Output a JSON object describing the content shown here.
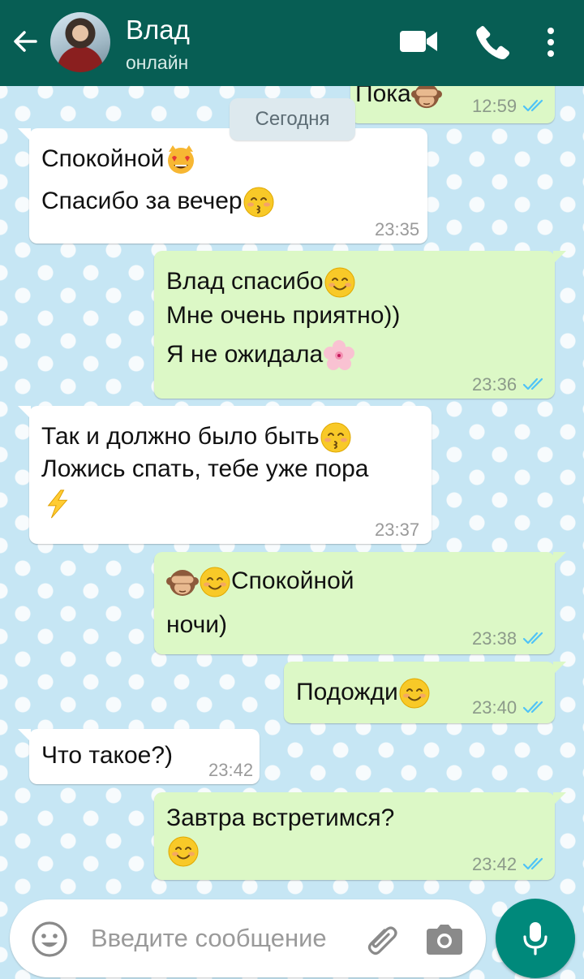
{
  "header": {
    "contact_name": "Влад",
    "status": "онлайн"
  },
  "date_divider": "Сегодня",
  "messages": [
    {
      "lines": [
        "Пока"
      ],
      "time": "12:59",
      "direction": "outgoing",
      "read": true,
      "emoji": [
        "see-no-evil-monkey"
      ]
    },
    {
      "lines": [
        "Спокойной",
        "Спасибо за вечер"
      ],
      "time": "23:35",
      "direction": "incoming",
      "emoji": [
        "heart-eyes-cat",
        "kissing-face"
      ]
    },
    {
      "lines": [
        "Влад спасибо",
        "Мне очень приятно))",
        "Я не ожидала"
      ],
      "time": "23:36",
      "direction": "outgoing",
      "read": true,
      "emoji": [
        "smiling-face",
        "cherry-blossom"
      ]
    },
    {
      "lines": [
        "Так и должно было быть",
        "Ложись спать, тебе уже пора"
      ],
      "time": "23:37",
      "direction": "incoming",
      "emoji": [
        "kissing-closed-eyes",
        "lightning"
      ]
    },
    {
      "lines": [
        "Спокойной",
        "ночи)"
      ],
      "time": "23:38",
      "direction": "outgoing",
      "read": true,
      "emoji": [
        "see-no-evil-monkey",
        "smiling-face"
      ]
    },
    {
      "lines": [
        "Подожди"
      ],
      "time": "23:40",
      "direction": "outgoing",
      "read": true,
      "emoji": [
        "relieved-face"
      ]
    },
    {
      "lines": [
        "Что такое?)"
      ],
      "time": "23:42",
      "direction": "incoming"
    },
    {
      "lines": [
        "Завтра встретимся?"
      ],
      "time": "23:42",
      "direction": "outgoing",
      "read": true,
      "emoji": [
        "relieved-face"
      ]
    }
  ],
  "input": {
    "placeholder": "Введите сообщение"
  },
  "colors": {
    "header": "#075e54",
    "outgoing_bubble": "#dcf8c6",
    "incoming_bubble": "#ffffff",
    "read_ticks": "#4fc3f7",
    "mic_button": "#00897b"
  }
}
